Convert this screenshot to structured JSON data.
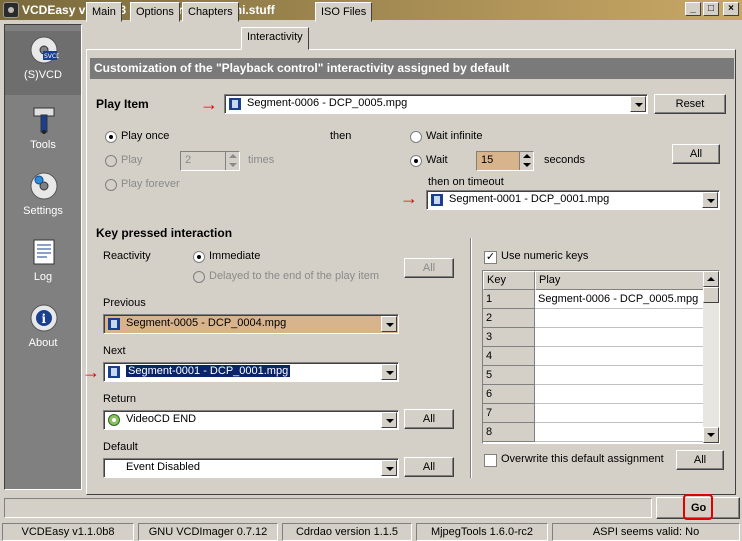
{
  "window": {
    "title": "VCDEasy v1.1.0b8 - Freeware by delphi.stuff",
    "minimize": "_",
    "maximize": "□",
    "close": "×"
  },
  "sidebar": {
    "items": [
      {
        "label": "(S)VCD",
        "icon": "disc-svcd-icon"
      },
      {
        "label": "Tools",
        "icon": "tools-icon"
      },
      {
        "label": "Settings",
        "icon": "settings-disc-icon"
      },
      {
        "label": "Log",
        "icon": "log-document-icon"
      },
      {
        "label": "About",
        "icon": "info-icon"
      }
    ]
  },
  "tabs": [
    {
      "label": "Main"
    },
    {
      "label": "Options"
    },
    {
      "label": "Chapters"
    },
    {
      "label": "Interactivity",
      "active": true
    },
    {
      "label": "ISO Files"
    }
  ],
  "banner": "Customization of the \"Playback control\" interactivity assigned by default",
  "play_item": {
    "label": "Play Item",
    "value": "Segment-0006 - DCP_0005.mpg",
    "reset": "Reset"
  },
  "play_mode": {
    "play_once": "Play once",
    "play": "Play",
    "play_count": "2",
    "times": "times",
    "play_forever": "Play forever",
    "then": "then",
    "wait_infinite": "Wait infinite",
    "wait": "Wait",
    "wait_value": "15",
    "seconds": "seconds",
    "all": "All",
    "then_on_timeout": "then on timeout",
    "timeout_value": "Segment-0001 - DCP_0001.mpg"
  },
  "key_pressed": {
    "title": "Key pressed interaction",
    "reactivity": "Reactivity",
    "immediate": "Immediate",
    "delayed": "Delayed to the end of the play item",
    "all_reactivity": "All",
    "previous_label": "Previous",
    "previous_value": "Segment-0005 - DCP_0004.mpg",
    "next_label": "Next",
    "next_value": "Segment-0001 - DCP_0001.mpg",
    "return_label": "Return",
    "return_value": "VideoCD END",
    "return_all": "All",
    "default_label": "Default",
    "default_value": "Event Disabled",
    "default_all": "All"
  },
  "numeric": {
    "use_numeric_keys": "Use numeric keys",
    "col_key": "Key",
    "col_play": "Play",
    "rows": [
      {
        "key": "1",
        "play": "Segment-0006 - DCP_0005.mpg"
      },
      {
        "key": "2",
        "play": ""
      },
      {
        "key": "3",
        "play": ""
      },
      {
        "key": "4",
        "play": ""
      },
      {
        "key": "5",
        "play": ""
      },
      {
        "key": "6",
        "play": ""
      },
      {
        "key": "7",
        "play": ""
      },
      {
        "key": "8",
        "play": ""
      }
    ],
    "overwrite": "Overwrite this default assignment",
    "all": "All"
  },
  "go_button": "Go",
  "status": [
    "VCDEasy v1.1.0b8",
    "GNU VCDImager 0.7.12",
    "Cdrdao version 1.1.5",
    "MjpegTools 1.6.0-rc2",
    "ASPI seems valid: No"
  ],
  "colors": {
    "accent_tan": "#d8b48c",
    "annotation_red": "#e00000",
    "selection": "#0a246a"
  }
}
